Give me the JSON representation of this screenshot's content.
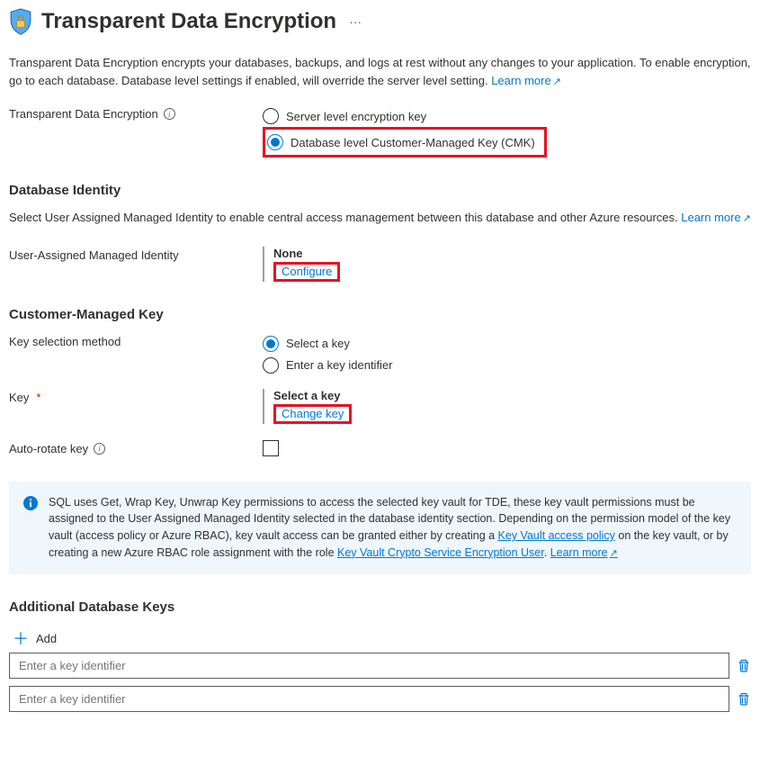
{
  "header": {
    "title": "Transparent Data Encryption"
  },
  "description": {
    "text_before_link": "Transparent Data Encryption encrypts your databases, backups, and logs at rest without any changes to your application. To enable encryption, go to each database. Database level settings if enabled, will override the server level setting. ",
    "link": "Learn more"
  },
  "tde": {
    "label": "Transparent Data Encryption",
    "option_server": "Server level encryption key",
    "option_database": "Database level Customer-Managed Key (CMK)"
  },
  "identity": {
    "heading": "Database Identity",
    "text_before_link": "Select User Assigned Managed Identity to enable central access management between this database and other Azure resources. ",
    "link": "Learn more",
    "uami_label": "User-Assigned Managed Identity",
    "uami_value": "None",
    "configure": "Configure"
  },
  "cmk": {
    "heading": "Customer-Managed Key",
    "key_selection_label": "Key selection method",
    "opt_select": "Select a key",
    "opt_enter": "Enter a key identifier",
    "key_label": "Key",
    "key_value": "Select a key",
    "change_key": "Change key",
    "autorotate_label": "Auto-rotate key"
  },
  "info_panel": {
    "t1": "SQL uses Get, Wrap Key, Unwrap Key permissions to access the selected key vault for TDE, these key vault permissions must be assigned to the User Assigned Managed Identity selected in the database identity section. Depending on the permission model of the key vault (access policy or Azure RBAC), key vault access can be granted either by creating a ",
    "link1": "Key Vault access policy",
    "t2": " on the key vault, or by creating a new Azure RBAC role assignment with the role ",
    "link2": "Key Vault Crypto Service Encryption User",
    "t3": ". ",
    "learn_more": "Learn more"
  },
  "additional": {
    "heading": "Additional Database Keys",
    "add_label": "Add",
    "placeholder": "Enter a key identifier"
  }
}
